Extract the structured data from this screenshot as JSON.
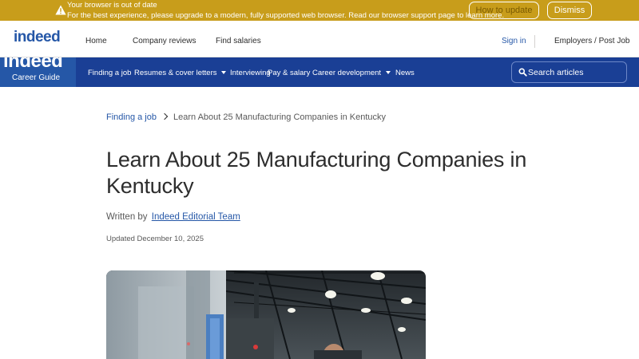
{
  "warning": {
    "title": "Your browser is out of date",
    "text": "For the best experience, please upgrade to a modern, fully supported web browser. Read our browser support page to learn more.",
    "update_label": "How to update",
    "dismiss_label": "Dismiss",
    "icon": "warning-triangle-icon",
    "background": "#c89d1b"
  },
  "topnav": {
    "logo": "indeed",
    "links": [
      "Home",
      "Company reviews",
      "Find salaries"
    ],
    "sign_in": "Sign in",
    "employers": "Employers / Post Job"
  },
  "career_nav": {
    "brand_logo": "indeed",
    "brand_sub": "Career Guide",
    "items": [
      "Finding a job",
      "Resumes & cover letters",
      "Interviewing",
      "Pay & salary",
      "Career development",
      "News"
    ],
    "search_placeholder": "Search articles",
    "background": "#1a3f95",
    "brand_background": "#2557a7"
  },
  "article": {
    "breadcrumb_parent": "Finding a job",
    "breadcrumb_current": "Learn About 25 Manufacturing Companies in Kentucky",
    "title": "Learn About 25 Manufacturing Companies in Kentucky",
    "written_by": "Written by",
    "author": "Indeed Editorial Team",
    "updated": "Updated December 10, 2025",
    "link_color": "#2557a7"
  }
}
